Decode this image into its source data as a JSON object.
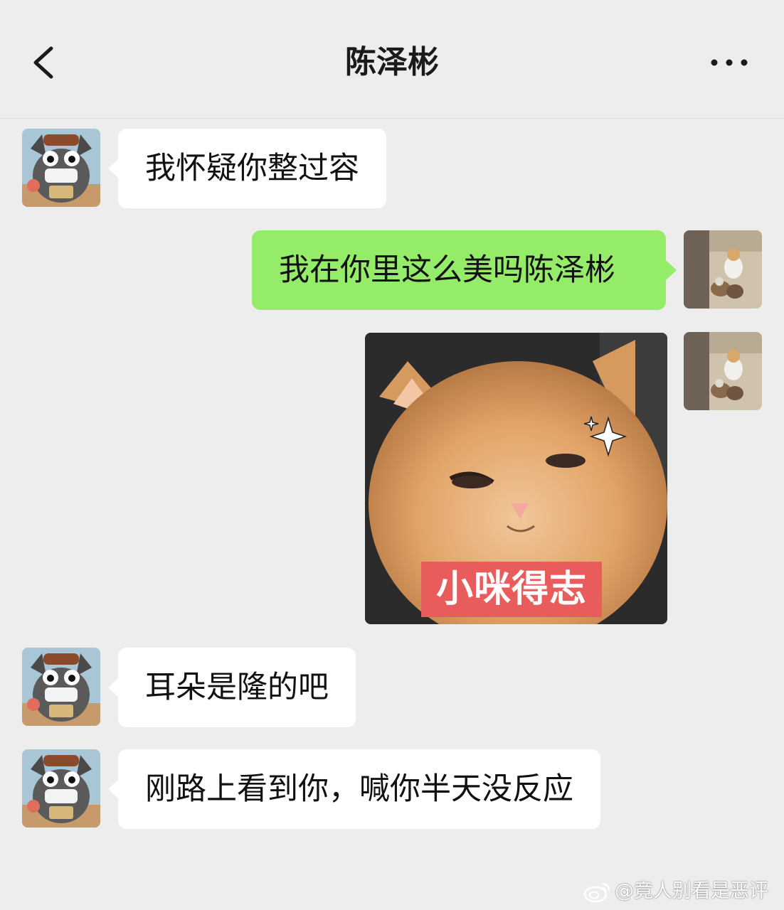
{
  "header": {
    "title": "陈泽彬",
    "back_icon": "chevron-left-icon",
    "more_icon": "ellipsis-icon"
  },
  "colors": {
    "background": "#ededed",
    "incoming_bubble": "#ffffff",
    "outgoing_bubble": "#95ec69",
    "sticker_caption_bg": "#e85c5c"
  },
  "messages": [
    {
      "direction": "incoming",
      "type": "text",
      "text": "我怀疑你整过容"
    },
    {
      "direction": "outgoing",
      "type": "text",
      "text": "我在你里这么美吗陈泽彬"
    },
    {
      "direction": "outgoing",
      "type": "sticker",
      "caption": "小咪得志"
    },
    {
      "direction": "incoming",
      "type": "text",
      "text": "耳朵是隆的吧"
    },
    {
      "direction": "incoming",
      "type": "text",
      "text": "刚路上看到你，喊你半天没反应"
    }
  ],
  "watermark": {
    "text": "@竟人别看是恶评"
  }
}
